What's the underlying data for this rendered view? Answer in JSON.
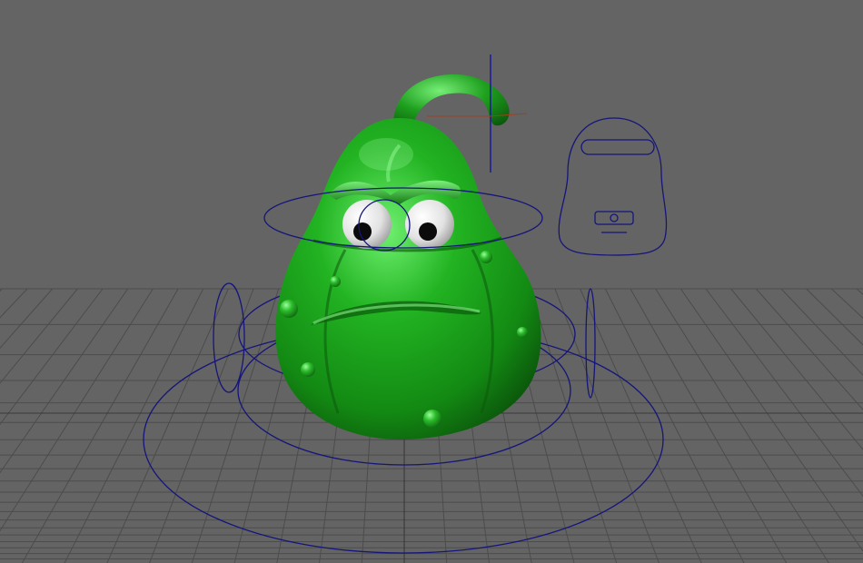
{
  "app": {
    "viewport": "3d-perspective-viewport",
    "content": "rigged-cartoon-gourd-character"
  },
  "colors": {
    "background": "#646464",
    "grid": "#4a4a4a",
    "grid_axis": "#333333",
    "rig_curve": "#1a1a7a",
    "body_dark": "#0a5a0a",
    "body_mid": "#1f9a1f",
    "body_light": "#5fe05f",
    "eye_white": "#f2f2f2",
    "pupil": "#0b0b0b",
    "axis_red": "#a04020"
  },
  "scene": {
    "character": {
      "name_icon": "gourd-character",
      "expression": "grumpy"
    },
    "controls": [
      {
        "name": "root-ring-control"
      },
      {
        "name": "body-ring-control"
      },
      {
        "name": "waist-ring-control"
      },
      {
        "name": "head-ring-control"
      },
      {
        "name": "eye-aim-control"
      },
      {
        "name": "left-side-control"
      },
      {
        "name": "right-side-control"
      },
      {
        "name": "face-picker-panel"
      },
      {
        "name": "stem-pivot-manipulator"
      }
    ]
  }
}
